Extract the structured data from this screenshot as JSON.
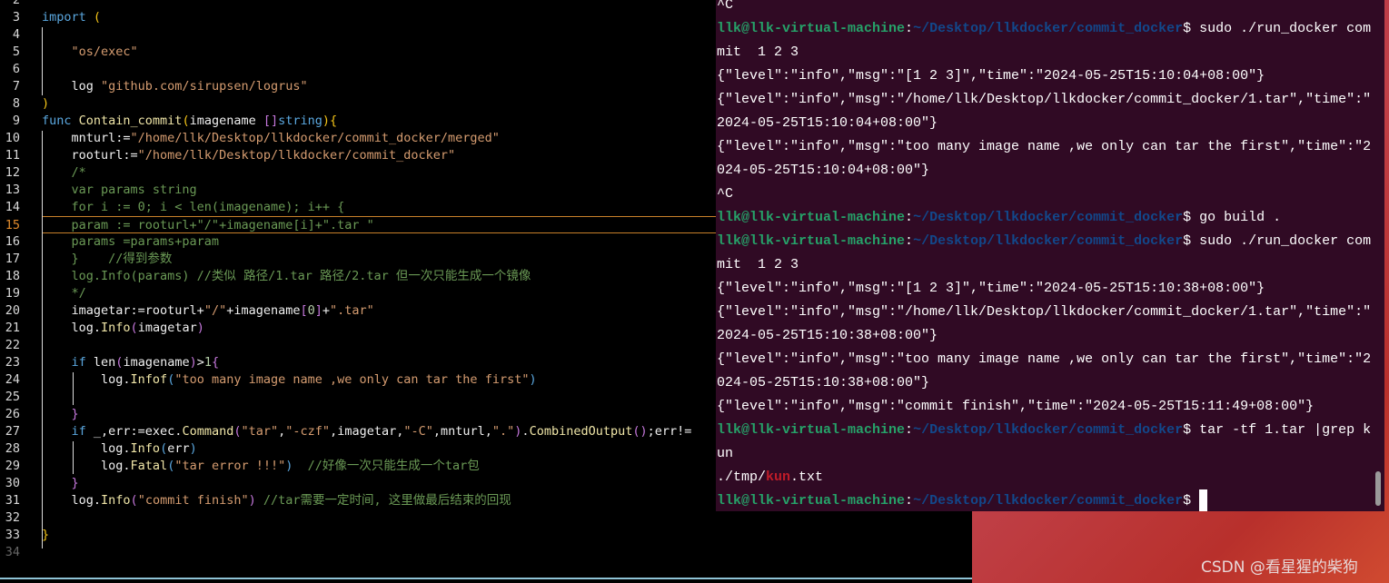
{
  "editor": {
    "lines": [
      {
        "n": "2",
        "t": []
      },
      {
        "n": "3",
        "t": [
          [
            "kw",
            "import "
          ],
          [
            "py",
            "("
          ]
        ]
      },
      {
        "n": "4",
        "t": []
      },
      {
        "n": "5",
        "t": [
          [
            "id",
            "    "
          ],
          [
            "st",
            "\"os/exec\""
          ]
        ]
      },
      {
        "n": "6",
        "t": []
      },
      {
        "n": "7",
        "t": [
          [
            "id",
            "    log "
          ],
          [
            "st",
            "\"github.com/sirupsen/logrus\""
          ]
        ]
      },
      {
        "n": "8",
        "t": [
          [
            "py",
            ")"
          ]
        ]
      },
      {
        "n": "9",
        "t": [
          [
            "kw",
            "func "
          ],
          [
            "fn",
            "Contain_commit"
          ],
          [
            "py",
            "("
          ],
          [
            "id",
            "imagename "
          ],
          [
            "pp",
            "[]"
          ],
          [
            "kw",
            "string"
          ],
          [
            "py",
            "){"
          ]
        ]
      },
      {
        "n": "10",
        "t": [
          [
            "id",
            "    mnturl:="
          ],
          [
            "st",
            "\"/home/llk/Desktop/llkdocker/commit_docker/merged\""
          ]
        ]
      },
      {
        "n": "11",
        "t": [
          [
            "id",
            "    rooturl:="
          ],
          [
            "st",
            "\"/home/llk/Desktop/llkdocker/commit_docker\""
          ]
        ]
      },
      {
        "n": "12",
        "t": [
          [
            "cm",
            "    /*"
          ]
        ]
      },
      {
        "n": "13",
        "t": [
          [
            "cm",
            "    var params string"
          ]
        ]
      },
      {
        "n": "14",
        "t": [
          [
            "cm",
            "    for i := 0; i < len(imagename); i++ {"
          ]
        ]
      },
      {
        "n": "15",
        "t": [
          [
            "cm",
            "    param := rooturl+\"/\"+imagename[i]+\".tar \""
          ]
        ],
        "current": true
      },
      {
        "n": "16",
        "t": [
          [
            "cm",
            "    params =params+param"
          ]
        ]
      },
      {
        "n": "17",
        "t": [
          [
            "cm",
            "    }    //得到参数"
          ]
        ]
      },
      {
        "n": "18",
        "t": [
          [
            "cm",
            "    log.Info(params) //类似 路径/1.tar 路径/2.tar 但一次只能生成一个镜像"
          ]
        ]
      },
      {
        "n": "19",
        "t": [
          [
            "cm",
            "    */"
          ]
        ]
      },
      {
        "n": "20",
        "t": [
          [
            "id",
            "    imagetar:=rooturl+"
          ],
          [
            "st",
            "\"/\""
          ],
          [
            "id",
            "+imagename"
          ],
          [
            "pp",
            "["
          ],
          [
            "nm",
            "0"
          ],
          [
            "pp",
            "]"
          ],
          [
            "id",
            "+"
          ],
          [
            "st",
            "\".tar\""
          ]
        ]
      },
      {
        "n": "21",
        "t": [
          [
            "id",
            "    log."
          ],
          [
            "fn",
            "Info"
          ],
          [
            "pp",
            "("
          ],
          [
            "id",
            "imagetar"
          ],
          [
            "pp",
            ")"
          ]
        ]
      },
      {
        "n": "22",
        "t": []
      },
      {
        "n": "23",
        "t": [
          [
            "kw",
            "    if "
          ],
          [
            "id",
            "len"
          ],
          [
            "pp",
            "("
          ],
          [
            "id",
            "imagename"
          ],
          [
            "pp",
            ")"
          ],
          [
            "id",
            ">"
          ],
          [
            "nm",
            "1"
          ],
          [
            "pp",
            "{"
          ]
        ]
      },
      {
        "n": "24",
        "t": [
          [
            "id",
            "        log."
          ],
          [
            "fn",
            "Infof"
          ],
          [
            "pb",
            "("
          ],
          [
            "st",
            "\"too many image name ,we only can tar the first\""
          ],
          [
            "pb",
            ")"
          ]
        ]
      },
      {
        "n": "25",
        "t": []
      },
      {
        "n": "26",
        "t": [
          [
            "pp",
            "    }"
          ]
        ]
      },
      {
        "n": "27",
        "t": [
          [
            "kw",
            "    if "
          ],
          [
            "id",
            "_,err:=exec."
          ],
          [
            "fn",
            "Command"
          ],
          [
            "pp",
            "("
          ],
          [
            "st",
            "\"tar\""
          ],
          [
            "id",
            ","
          ],
          [
            "st",
            "\"-czf\""
          ],
          [
            "id",
            ",imagetar,"
          ],
          [
            "st",
            "\"-C\""
          ],
          [
            "id",
            ",mnturl,"
          ],
          [
            "st",
            "\".\""
          ],
          [
            "pp",
            ")"
          ],
          [
            "id",
            "."
          ],
          [
            "fn",
            "CombinedOutput"
          ],
          [
            "pp",
            "()"
          ],
          [
            "id",
            ";err!="
          ]
        ]
      },
      {
        "n": "28",
        "t": [
          [
            "id",
            "        log."
          ],
          [
            "fn",
            "Info"
          ],
          [
            "pb",
            "("
          ],
          [
            "id",
            "err"
          ],
          [
            "pb",
            ")"
          ]
        ]
      },
      {
        "n": "29",
        "t": [
          [
            "id",
            "        log."
          ],
          [
            "fn",
            "Fatal"
          ],
          [
            "pb",
            "("
          ],
          [
            "st",
            "\"tar error !!!\""
          ],
          [
            "pb",
            ")"
          ],
          [
            "cm",
            "  //好像一次只能生成一个tar包"
          ]
        ]
      },
      {
        "n": "30",
        "t": [
          [
            "pp",
            "    }"
          ]
        ]
      },
      {
        "n": "31",
        "t": [
          [
            "id",
            "    log."
          ],
          [
            "fn",
            "Info"
          ],
          [
            "pp",
            "("
          ],
          [
            "st",
            "\"commit finish\""
          ],
          [
            "pp",
            ")"
          ],
          [
            "cm",
            " //tar需要一定时间, 这里做最后结束的回现"
          ]
        ]
      },
      {
        "n": "32",
        "t": []
      },
      {
        "n": "33",
        "t": [
          [
            "py",
            "}"
          ]
        ]
      },
      {
        "n": "34",
        "t": [],
        "dim": true
      }
    ]
  },
  "terminal": {
    "lines": [
      [
        [
          "",
          "^C"
        ]
      ],
      [
        [
          "user",
          "llk@llk-virtual-machine"
        ],
        [
          "",
          ":"
        ],
        [
          "path",
          "~/Desktop/llkdocker/commit_docker"
        ],
        [
          "",
          "$ sudo ./run_docker com"
        ]
      ],
      [
        [
          "",
          "mit  1 2 3"
        ]
      ],
      [
        [
          "",
          "{\"level\":\"info\",\"msg\":\"[1 2 3]\",\"time\":\"2024-05-25T15:10:04+08:00\"}"
        ]
      ],
      [
        [
          "",
          "{\"level\":\"info\",\"msg\":\"/home/llk/Desktop/llkdocker/commit_docker/1.tar\",\"time\":\""
        ]
      ],
      [
        [
          "",
          "2024-05-25T15:10:04+08:00\"}"
        ]
      ],
      [
        [
          "",
          "{\"level\":\"info\",\"msg\":\"too many image name ,we only can tar the first\",\"time\":\"2"
        ]
      ],
      [
        [
          "",
          "024-05-25T15:10:04+08:00\"}"
        ]
      ],
      [
        [
          "",
          "^C"
        ]
      ],
      [
        [
          "user",
          "llk@llk-virtual-machine"
        ],
        [
          "",
          ":"
        ],
        [
          "path",
          "~/Desktop/llkdocker/commit_docker"
        ],
        [
          "",
          "$ go build ."
        ]
      ],
      [
        [
          "user",
          "llk@llk-virtual-machine"
        ],
        [
          "",
          ":"
        ],
        [
          "path",
          "~/Desktop/llkdocker/commit_docker"
        ],
        [
          "",
          "$ sudo ./run_docker com"
        ]
      ],
      [
        [
          "",
          "mit  1 2 3"
        ]
      ],
      [
        [
          "",
          "{\"level\":\"info\",\"msg\":\"[1 2 3]\",\"time\":\"2024-05-25T15:10:38+08:00\"}"
        ]
      ],
      [
        [
          "",
          "{\"level\":\"info\",\"msg\":\"/home/llk/Desktop/llkdocker/commit_docker/1.tar\",\"time\":\""
        ]
      ],
      [
        [
          "",
          "2024-05-25T15:10:38+08:00\"}"
        ]
      ],
      [
        [
          "",
          "{\"level\":\"info\",\"msg\":\"too many image name ,we only can tar the first\",\"time\":\"2"
        ]
      ],
      [
        [
          "",
          "024-05-25T15:10:38+08:00\"}"
        ]
      ],
      [
        [
          "",
          "{\"level\":\"info\",\"msg\":\"commit finish\",\"time\":\"2024-05-25T15:11:49+08:00\"}"
        ]
      ],
      [
        [
          "user",
          "llk@llk-virtual-machine"
        ],
        [
          "",
          ":"
        ],
        [
          "path",
          "~/Desktop/llkdocker/commit_docker"
        ],
        [
          "",
          "$ tar -tf 1.tar |grep k"
        ]
      ],
      [
        [
          "",
          "un"
        ]
      ],
      [
        [
          "",
          "./tmp/"
        ],
        [
          "red",
          "kun"
        ],
        [
          "",
          ".txt"
        ]
      ],
      [
        [
          "user",
          "llk@llk-virtual-machine"
        ],
        [
          "",
          ":"
        ],
        [
          "path",
          "~/Desktop/llkdocker/commit_docker"
        ],
        [
          "",
          "$ "
        ]
      ]
    ]
  },
  "watermark": "CSDN @看星猩的柴狗"
}
